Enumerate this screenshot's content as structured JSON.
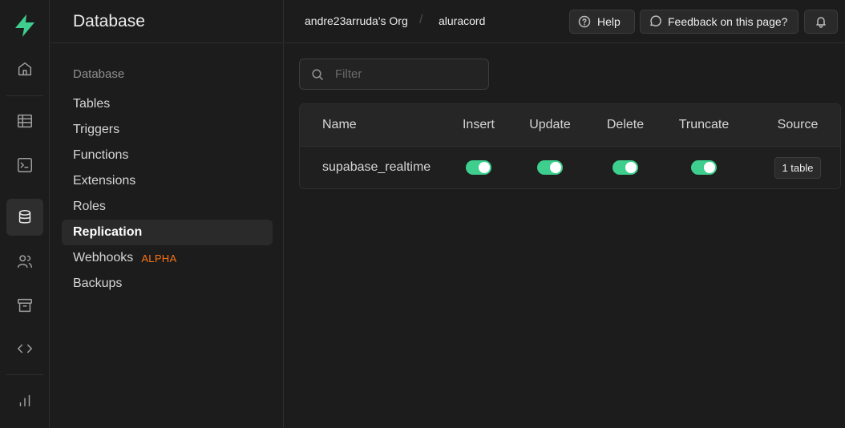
{
  "colors": {
    "brand": "#3ecf8e",
    "badge": "#f97316"
  },
  "rail": {
    "items": [
      {
        "icon": "home-icon"
      },
      {
        "icon": "table-editor-icon"
      },
      {
        "icon": "sql-editor-icon"
      },
      {
        "icon": "database-icon",
        "active": true
      },
      {
        "icon": "users-icon"
      },
      {
        "icon": "storage-icon"
      },
      {
        "icon": "code-icon"
      },
      {
        "icon": "reports-icon"
      }
    ]
  },
  "menu": {
    "title": "Database",
    "section_title": "Database",
    "items": [
      {
        "label": "Tables"
      },
      {
        "label": "Triggers"
      },
      {
        "label": "Functions"
      },
      {
        "label": "Extensions"
      },
      {
        "label": "Roles"
      },
      {
        "label": "Replication",
        "active": true
      },
      {
        "label": "Webhooks",
        "badge": "ALPHA"
      },
      {
        "label": "Backups"
      }
    ]
  },
  "topbar": {
    "org": "andre23arruda's Org",
    "separator": "/",
    "project": "aluracord",
    "help_label": "Help",
    "feedback_label": "Feedback on this page?"
  },
  "filter": {
    "placeholder": "Filter",
    "value": ""
  },
  "table": {
    "columns": [
      "Name",
      "Insert",
      "Update",
      "Delete",
      "Truncate",
      "Source"
    ],
    "rows": [
      {
        "name": "supabase_realtime",
        "insert": true,
        "update": true,
        "delete": true,
        "truncate": true,
        "source": "1 table"
      }
    ]
  }
}
